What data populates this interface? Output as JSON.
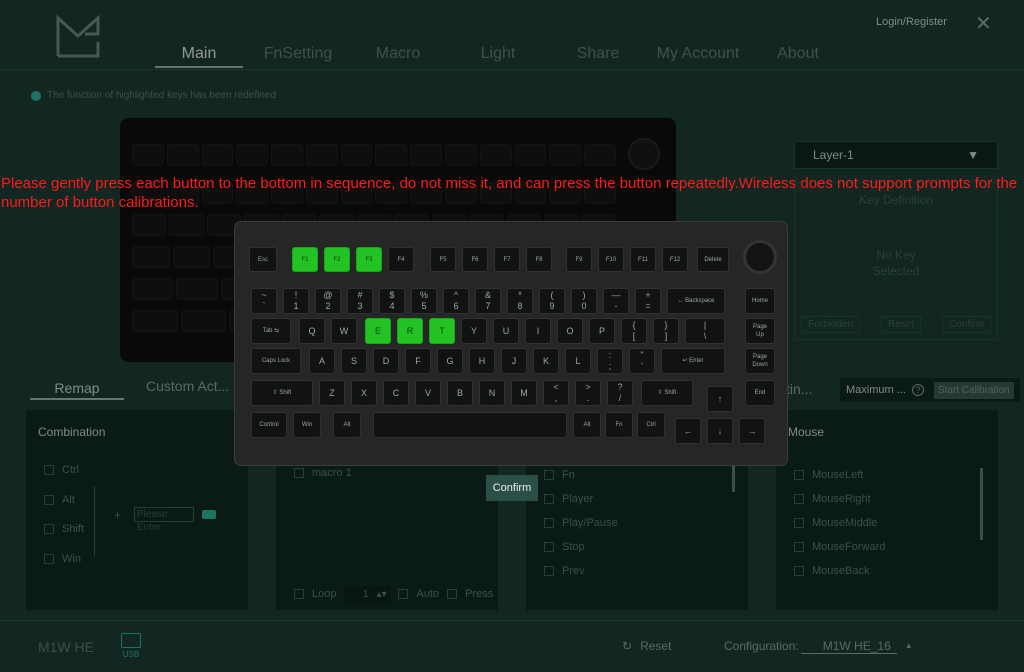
{
  "window": {
    "login": "Login/Register",
    "close": "✕"
  },
  "nav": {
    "tabs": [
      "Main",
      "FnSetting",
      "Macro",
      "Light",
      "Share",
      "My Account",
      "About"
    ]
  },
  "notice": "The function of highlighted keys has been redefined",
  "layer": {
    "selected": "Layer-1",
    "arrow": "▼"
  },
  "key_definition": {
    "title": "Key Definition",
    "no_key": "No Key\nSelected",
    "buttons": [
      "Forbidden",
      "Reset",
      "Confirm"
    ]
  },
  "subtabs": {
    "remap": "Remap",
    "custom": "Custom Act...",
    "hid": "tin...",
    "max_label": "Maximum ...",
    "help": "?",
    "start_cal": "Start Calibration"
  },
  "combination": {
    "title": "Combination",
    "mods": [
      "Ctrl",
      "Alt",
      "Shift",
      "Win"
    ],
    "plus": "+",
    "placeholder": "Please Enter"
  },
  "macro_panel": {
    "items": [
      "macro 1"
    ],
    "loop": "Loop",
    "count": "1",
    "spin": "▴▾",
    "auto": "Auto",
    "press": "Press"
  },
  "media_panel": {
    "items": [
      "Fn",
      "Player",
      "Play/Pause",
      "Stop",
      "Prev"
    ]
  },
  "mouse_panel": {
    "title": "Mouse",
    "items": [
      "MouseLeft",
      "MouseRight",
      "MouseMiddle",
      "MouseForward",
      "MouseBack"
    ]
  },
  "bottom": {
    "device": "M1W HE",
    "usb": "USB",
    "reset": "Reset",
    "reset_icon": "↻",
    "config_label": "Configuration:",
    "config_value": "M1W HE_16",
    "config_arrow": "▲"
  },
  "modal": {
    "warning": "Please gently press each button to the bottom in sequence, do not miss it, and can press the button repeatedly.Wireless does not support prompts for the number of button calibrations.",
    "confirm": "Confirm",
    "highlight_color": "#22c322",
    "keys": {
      "esc": "Esc",
      "f1": "F1",
      "f2": "F2",
      "f3": "F3",
      "f4": "F4",
      "f5": "F5",
      "f6": "F6",
      "f7": "F7",
      "f8": "F8",
      "f9": "F9",
      "f10": "F10",
      "f11": "F11",
      "f12": "F12",
      "delete": "Delete",
      "grave": "~\n`",
      "n1": "!\n1",
      "n2": "@\n2",
      "n3": "#\n3",
      "n4": "$\n4",
      "n5": "%\n5",
      "n6": "^\n6",
      "n7": "&\n7",
      "n8": "*\n8",
      "n9": "(\n9",
      "n0": ")\n0",
      "minus": "—\n-",
      "equal": "+\n=",
      "backspace": "← Backspace",
      "home": "Home",
      "tab": "Tab ⇆",
      "q": "Q",
      "w": "W",
      "e": "E",
      "r": "R",
      "t": "T",
      "y": "Y",
      "u": "U",
      "i": "I",
      "o": "O",
      "p": "P",
      "lbr": "{\n[",
      "rbr": "}\n]",
      "bslash": "|\n\\",
      "pgup": "Page\nUp",
      "caps": "Caps Lock",
      "a": "A",
      "s": "S",
      "d": "D",
      "f": "F",
      "g": "G",
      "h": "H",
      "j": "J",
      "k": "K",
      "l": "L",
      "semi": ":\n;",
      "quote": "\"\n'",
      "enter": "↵ Enter",
      "pgdn": "Page\nDown",
      "lshift": "⇧ Shift",
      "z": "Z",
      "x": "X",
      "c": "C",
      "v": "V",
      "b": "B",
      "n": "N",
      "m": "M",
      "comma": "<\n,",
      "period": ">\n.",
      "slash": "?\n/",
      "rshift": "⇧ Shift",
      "up": "↑",
      "end": "End",
      "lctrl": "Control",
      "lwin": "Win",
      "lalt": "Alt",
      "space": "",
      "ralt": "Alt",
      "fn": "Fn",
      "rctrl": "Ctrl",
      "left": "←",
      "down": "↓",
      "right": "→"
    }
  }
}
